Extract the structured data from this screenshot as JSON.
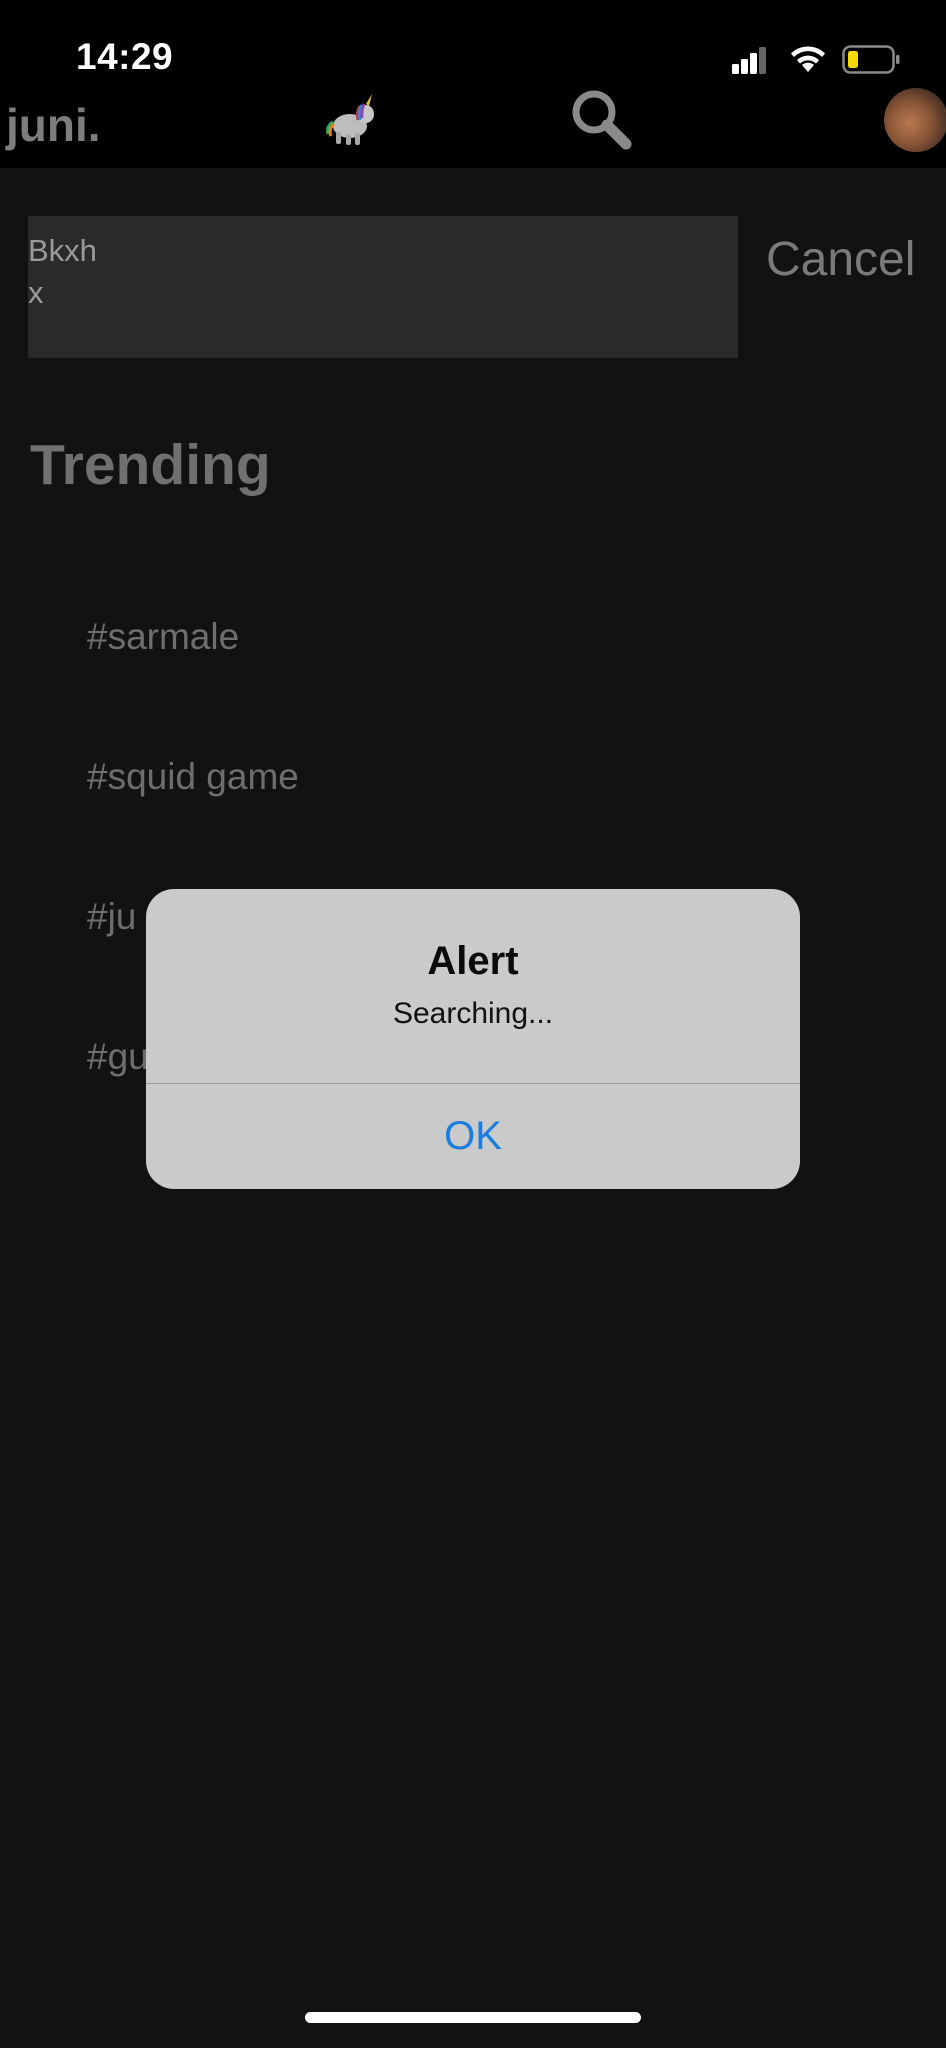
{
  "status_bar": {
    "time": "14:29",
    "icons": [
      "signal-icon",
      "wifi-icon",
      "battery-icon"
    ],
    "battery_color": "#f5d90a"
  },
  "header": {
    "brand": "juni.",
    "icons": [
      "unicorn-icon",
      "search-icon",
      "avatar"
    ]
  },
  "search": {
    "value": "Bkxh\nx",
    "cancel_label": "Cancel"
  },
  "trending": {
    "title": "Trending",
    "items": [
      "#sarmale",
      "#squid game",
      "#ju",
      "#gu"
    ]
  },
  "alert": {
    "title": "Alert",
    "message": "Searching...",
    "ok_label": "OK",
    "ok_color": "#1a7de0"
  }
}
